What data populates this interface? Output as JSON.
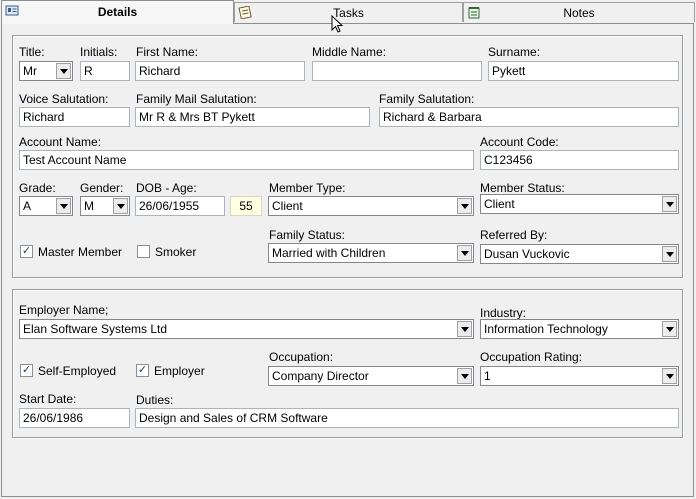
{
  "tabs": [
    {
      "label": "Details",
      "icon": "card-icon"
    },
    {
      "label": "Tasks",
      "icon": "notepad-icon"
    },
    {
      "label": "Notes",
      "icon": "note-pad-icon"
    }
  ],
  "personal": {
    "title": {
      "label": "Title:",
      "value": "Mr"
    },
    "initials": {
      "label": "Initials:",
      "value": "R"
    },
    "first_name": {
      "label": "First Name:",
      "value": "Richard"
    },
    "middle_name": {
      "label": "Middle Name:",
      "value": ""
    },
    "surname": {
      "label": "Surname:",
      "value": "Pykett"
    },
    "voice_salutation": {
      "label": "Voice Salutation:",
      "value": "Richard"
    },
    "family_mail_salutation": {
      "label": "Family Mail Salutation:",
      "value": "Mr R & Mrs BT Pykett"
    },
    "family_salutation": {
      "label": "Family Salutation:",
      "value": "Richard & Barbara"
    },
    "account_name": {
      "label": "Account Name:",
      "value": "Test Account Name"
    },
    "account_code": {
      "label": "Account Code:",
      "value": "C123456"
    },
    "grade": {
      "label": "Grade:",
      "value": "A"
    },
    "gender": {
      "label": "Gender:",
      "value": "M"
    },
    "dob": {
      "label": "DOB - Age:",
      "value": "26/06/1955",
      "age": "55"
    },
    "member_type": {
      "label": "Member Type:",
      "value": "Client"
    },
    "member_status": {
      "label": "Member Status:",
      "value": "Client"
    },
    "master_member": {
      "label": "Master Member",
      "checked": true
    },
    "smoker": {
      "label": "Smoker",
      "checked": false
    },
    "family_status": {
      "label": "Family Status:",
      "value": "Married with Children"
    },
    "referred_by": {
      "label": "Referred By:",
      "value": "Dusan Vuckovic"
    }
  },
  "employment": {
    "employer_name": {
      "label": "Employer Name;",
      "value": "Elan Software Systems Ltd"
    },
    "industry": {
      "label": "Industry:",
      "value": "Information Technology"
    },
    "self_employed": {
      "label": "Self-Employed",
      "checked": true
    },
    "employer": {
      "label": "Employer",
      "checked": true
    },
    "occupation": {
      "label": "Occupation:",
      "value": "Company Director"
    },
    "occupation_rating": {
      "label": "Occupation Rating:",
      "value": "1"
    },
    "start_date": {
      "label": "Start Date:",
      "value": "26/06/1986"
    },
    "duties": {
      "label": "Duties:",
      "value": "Design and Sales of CRM Software"
    }
  },
  "check_mark": "✓"
}
